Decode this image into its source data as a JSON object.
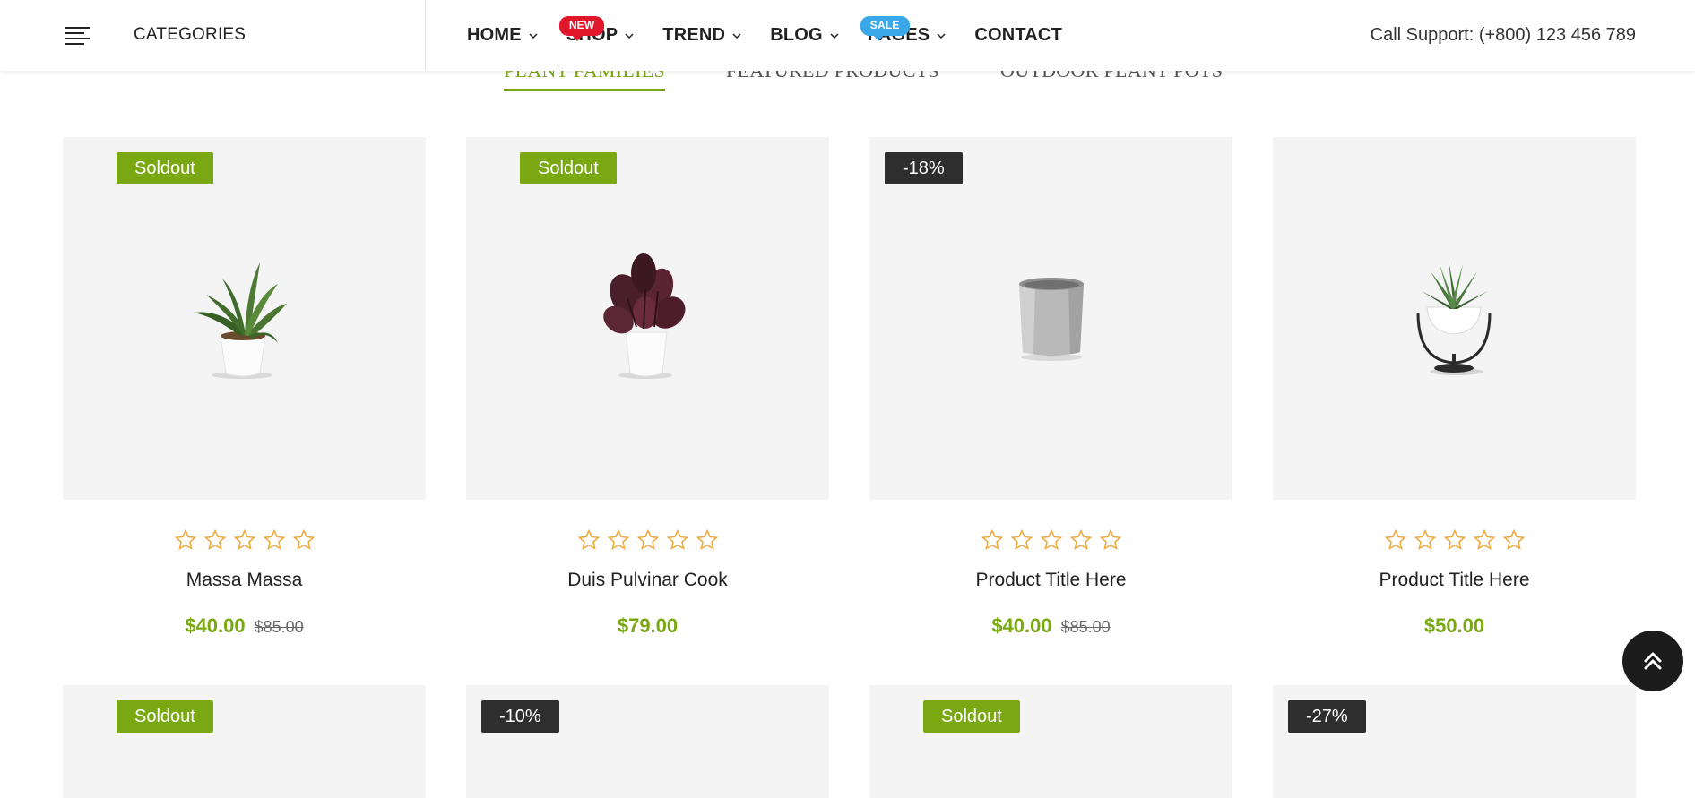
{
  "header": {
    "categories_label": "CATEGORIES",
    "nav": [
      {
        "label": "HOME",
        "badge": ""
      },
      {
        "label": "SHOP",
        "badge": "NEW"
      },
      {
        "label": "TREND",
        "badge": ""
      },
      {
        "label": "BLOG",
        "badge": ""
      },
      {
        "label": "PAGES",
        "badge": "SALE"
      },
      {
        "label": "CONTACT",
        "badge": ""
      }
    ],
    "support": "Call Support: (+800) 123 456 789"
  },
  "tabs": [
    {
      "label": "PLANT FAMILIES",
      "active": true
    },
    {
      "label": "FEATURED PRODUCTS",
      "active": false
    },
    {
      "label": "OUTDOOR PLANT POTS",
      "active": false
    }
  ],
  "products": [
    {
      "label": "Soldout",
      "title": "Massa Massa",
      "price": "$40.00",
      "old_price": "$85.00",
      "rating": 0,
      "image": "snake-plant"
    },
    {
      "label": "Soldout",
      "title": "Duis Pulvinar Cook",
      "price": "$79.00",
      "old_price": "",
      "rating": 0,
      "image": "calathea-plant"
    },
    {
      "label": "-18%",
      "title": "Product Title Here",
      "price": "$40.00",
      "old_price": "$85.00",
      "rating": 0,
      "image": "concrete-pot"
    },
    {
      "label": "",
      "title": "Product Title Here",
      "price": "$50.00",
      "old_price": "",
      "rating": 0,
      "image": "hanging-succulent"
    }
  ],
  "products_row2": [
    {
      "label": "Soldout"
    },
    {
      "label": "-10%"
    },
    {
      "label": "Soldout"
    },
    {
      "label": "-27%"
    }
  ],
  "colors": {
    "accent": "#7aa813",
    "badge_new": "#e0172b",
    "badge_sale": "#3aa8e8",
    "discount_label": "#2e2e2e",
    "star": "#f0a839"
  }
}
